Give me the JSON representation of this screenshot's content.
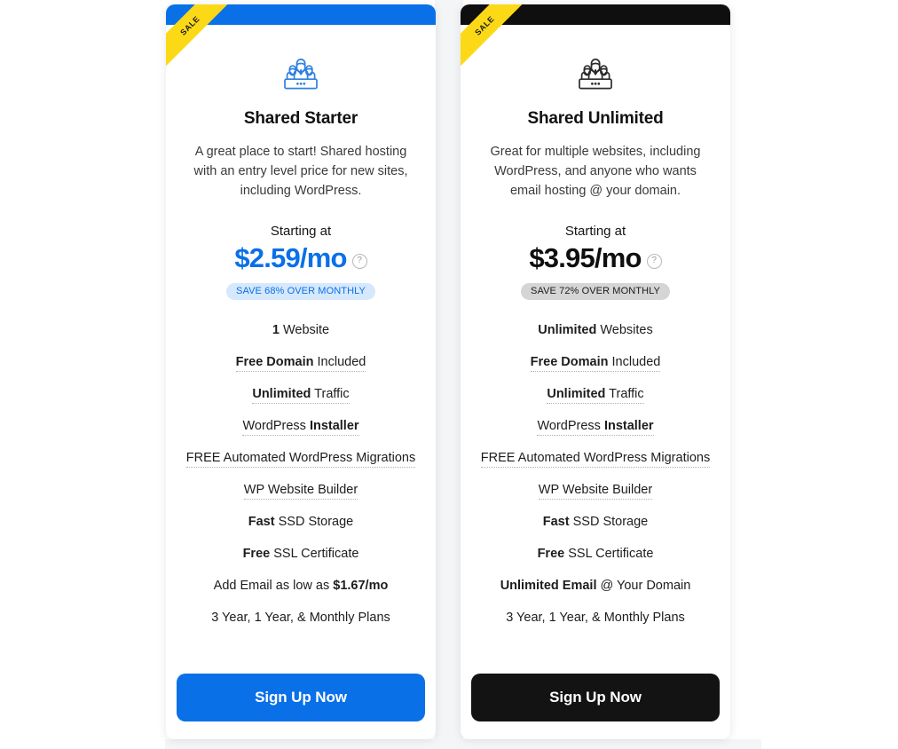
{
  "page": {
    "background_color": "#ffffff",
    "gap_color": "#f4f5f7"
  },
  "ribbon": {
    "label": "SALE",
    "color": "#fcd917"
  },
  "help_icon": {
    "glyph": "?"
  },
  "plans": [
    {
      "accent_color": "#0a70e8",
      "topbar_color": "#0a70e8",
      "icon_name": "team-people-icon",
      "name": "Shared Starter",
      "description": "A great place to start! Shared hosting with an entry level price for new sites, including WordPress.",
      "starting_label": "Starting at",
      "price": "$2.59",
      "price_period": "/mo",
      "save_badge": "SAVE 68% OVER MONTHLY",
      "save_badge_bg": "#d6e8fc",
      "features": [
        {
          "bold": "1",
          "rest": " Website",
          "dotted": false
        },
        {
          "bold": "Free Domain",
          "rest": " Included",
          "dotted": true
        },
        {
          "bold": "Unlimited",
          "rest": " Traffic",
          "dotted": true
        },
        {
          "bold": "",
          "rest": "WordPress ",
          "bold_after": "Installer",
          "dotted": true
        },
        {
          "bold": "",
          "rest": "FREE Automated WordPress Migrations",
          "dotted": true
        },
        {
          "bold": "",
          "rest": "WP Website Builder",
          "dotted": true
        },
        {
          "bold": "Fast",
          "rest": " SSD Storage",
          "dotted": false
        },
        {
          "bold": "Free",
          "rest": " SSL Certificate",
          "dotted": false
        },
        {
          "bold": "",
          "rest": "Add Email as low as ",
          "bold_after": "$1.67/mo",
          "dotted": false
        },
        {
          "bold": "",
          "rest": "3 Year, 1 Year, & Monthly Plans",
          "dotted": false
        }
      ],
      "cta_label": "Sign Up Now",
      "cta_color": "#0a70e8"
    },
    {
      "accent_color": "#0f0f0f",
      "topbar_color": "#0f0f0f",
      "icon_name": "team-people-icon",
      "name": "Shared Unlimited",
      "description": "Great for multiple websites, including WordPress, and anyone who wants email hosting @ your domain.",
      "starting_label": "Starting at",
      "price": "$3.95",
      "price_period": "/mo",
      "save_badge": "SAVE 72% OVER MONTHLY",
      "save_badge_bg": "#d5d5d5",
      "features": [
        {
          "bold": "Unlimited",
          "rest": " Websites",
          "dotted": false
        },
        {
          "bold": "Free Domain",
          "rest": " Included",
          "dotted": true
        },
        {
          "bold": "Unlimited",
          "rest": " Traffic",
          "dotted": true
        },
        {
          "bold": "",
          "rest": "WordPress ",
          "bold_after": "Installer",
          "dotted": true
        },
        {
          "bold": "",
          "rest": "FREE Automated WordPress Migrations",
          "dotted": true
        },
        {
          "bold": "",
          "rest": "WP Website Builder",
          "dotted": true
        },
        {
          "bold": "Fast",
          "rest": " SSD Storage",
          "dotted": false
        },
        {
          "bold": "Free",
          "rest": " SSL Certificate",
          "dotted": false
        },
        {
          "bold": "Unlimited Email",
          "rest": " @ Your Domain",
          "dotted": false
        },
        {
          "bold": "",
          "rest": "3 Year, 1 Year, & Monthly Plans",
          "dotted": false
        }
      ],
      "cta_label": "Sign Up Now",
      "cta_color": "#131313"
    }
  ]
}
